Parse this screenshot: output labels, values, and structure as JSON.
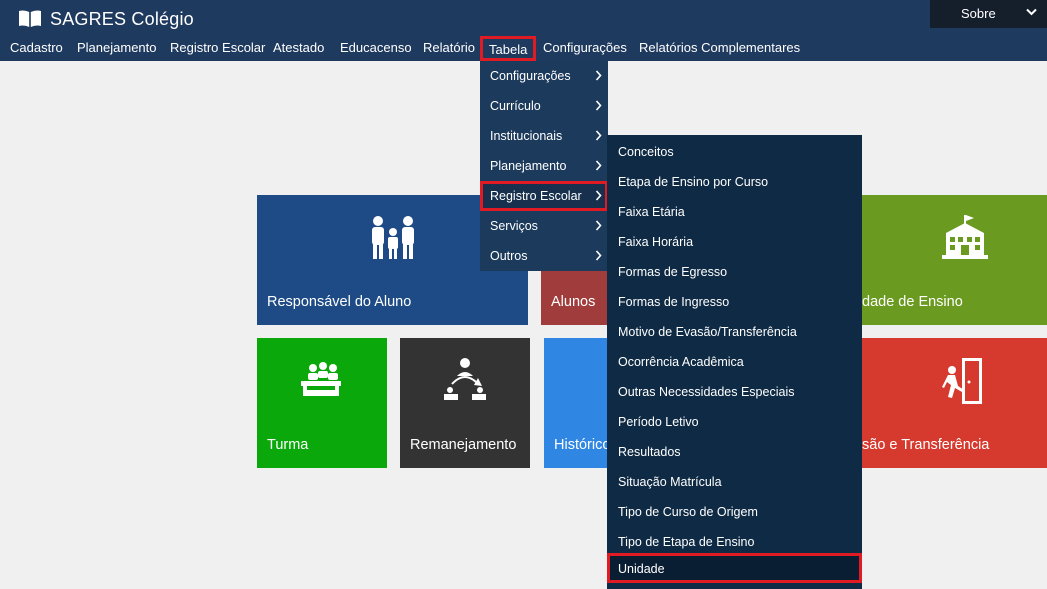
{
  "app": {
    "title": "SAGRES Colégio"
  },
  "header": {
    "sobre_label": "Sobre"
  },
  "menu": {
    "items": [
      {
        "label": "Cadastro"
      },
      {
        "label": "Planejamento"
      },
      {
        "label": "Registro Escolar"
      },
      {
        "label": "Atestado"
      },
      {
        "label": "Educacenso"
      },
      {
        "label": "Relatório"
      },
      {
        "label": "Tabela"
      },
      {
        "label": "Configurações"
      },
      {
        "label": "Relatórios Complementares"
      }
    ]
  },
  "tabela_menu": {
    "items": [
      {
        "label": "Configurações"
      },
      {
        "label": "Currículo"
      },
      {
        "label": "Institucionais"
      },
      {
        "label": "Planejamento"
      },
      {
        "label": "Registro Escolar"
      },
      {
        "label": "Serviços"
      },
      {
        "label": "Outros"
      }
    ]
  },
  "registro_escolar_submenu": {
    "items": [
      {
        "label": "Conceitos"
      },
      {
        "label": "Etapa de Ensino por Curso"
      },
      {
        "label": "Faixa Etária"
      },
      {
        "label": "Faixa Horária"
      },
      {
        "label": "Formas de Egresso"
      },
      {
        "label": "Formas de Ingresso"
      },
      {
        "label": "Motivo de Evasão/Transferência"
      },
      {
        "label": "Ocorrência Acadêmica"
      },
      {
        "label": "Outras Necessidades Especiais"
      },
      {
        "label": "Período Letivo"
      },
      {
        "label": "Resultados"
      },
      {
        "label": "Situação Matrícula"
      },
      {
        "label": "Tipo de Curso de Origem"
      },
      {
        "label": "Tipo de Etapa de Ensino"
      },
      {
        "label": "Unidade"
      }
    ]
  },
  "tiles": {
    "responsavel": {
      "label": "Responsável do Aluno",
      "color": "#1e4b86",
      "icon": "family-icon"
    },
    "alunos": {
      "label": "Alunos",
      "color": "#a13c3c",
      "icon": "student-icon"
    },
    "unidade": {
      "label": "dade de Ensino",
      "color": "#6a9a1f",
      "icon": "school-building-icon"
    },
    "turma": {
      "label": "Turma",
      "color": "#0aa80a",
      "icon": "classroom-icon"
    },
    "remanejamento": {
      "label": "Remanejamento",
      "color": "#333333",
      "icon": "reassign-icon"
    },
    "historico": {
      "label": "Histórico",
      "color": "#2f87e3",
      "icon": "history-icon"
    },
    "evasao": {
      "label": "são e Transferência",
      "color": "#d63a2f",
      "icon": "exit-door-icon"
    }
  },
  "colors": {
    "header_bg": "#1f3a5f",
    "dropdown_bg": "#1c3a5c",
    "submenu_bg": "#0f2a44",
    "highlight": "#e01b24",
    "page_bg": "#f0f0f0"
  }
}
